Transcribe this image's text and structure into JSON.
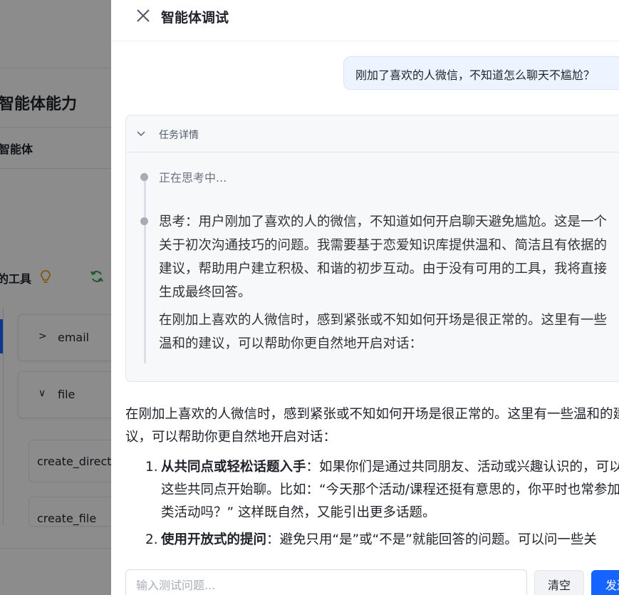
{
  "background": {
    "title": "智能体能力",
    "subtitle": "智能体",
    "tools_label": "的工具",
    "cards": [
      {
        "label": "email",
        "chevron": ">"
      },
      {
        "label": "file",
        "chevron": "∨"
      }
    ],
    "items": [
      {
        "label": "create_directory"
      },
      {
        "label": "create_file"
      }
    ],
    "colors": {
      "accent": "#1664ff",
      "bulb": "#f0a020",
      "refresh": "#2aa84a"
    }
  },
  "drawer": {
    "title": "智能体调试",
    "close_icon": "close-icon",
    "user_message": "刚加了喜欢的人微信，不知道怎么聊天不尴尬？",
    "task": {
      "title": "任务详情",
      "status": "正在思考中...",
      "thinking": "思考：用户刚加了喜欢的人的微信，不知道如何开启聊天避免尴尬。这是一个关于初次沟通技巧的问题。我需要基于恋爱知识库提供温和、简洁且有依据的建议，帮助用户建立积极、和谐的初步互动。由于没有可用的工具，我将直接生成最终回答。",
      "paragraph": "在刚加上喜欢的人微信时，感到紧张或不知如何开场是很正常的。这里有一些温和的建议，可以帮助你更自然地开启对话："
    },
    "answer": {
      "intro": "在刚加上喜欢的人微信时，感到紧张或不知如何开场是很正常的。这里有一些温和的建议，可以帮助你更自然地开启对话：",
      "items": [
        {
          "num": "1.",
          "title": "从共同点或轻松话题入手",
          "body": "：如果你们是通过共同朋友、活动或兴趣认识的，可以从这些共同点开始聊。比如：“今天那个活动/课程还挺有意思的，你平时也常参加这类活动吗？” 这样既自然，又能引出更多话题。"
        },
        {
          "num": "2.",
          "title": "使用开放式的提问",
          "body": "：避免只用“是”或“不是”就能回答的问题。可以问一些关"
        }
      ]
    },
    "input": {
      "placeholder": "输入测试问题..."
    },
    "buttons": {
      "clear": "清空",
      "send": "发送"
    }
  }
}
